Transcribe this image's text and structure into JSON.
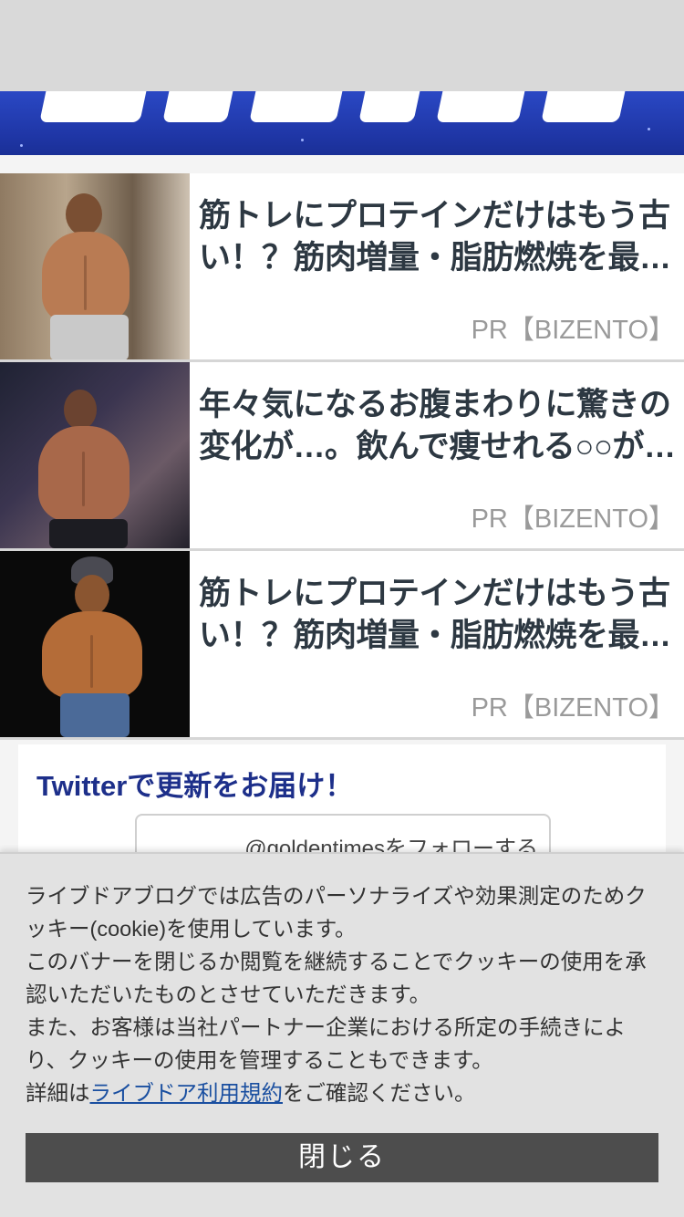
{
  "ads": [
    {
      "title": "筋トレにプロテインだけはもう古い！？筋肉増量・脂肪燃焼を最…",
      "sponsor": "PR【BIZENTO】"
    },
    {
      "title": "年々気になるお腹まわりに驚きの変化が…。飲んで痩せれる○○が…",
      "sponsor": "PR【BIZENTO】"
    },
    {
      "title": "筋トレにプロテインだけはもう古い！？筋肉増量・脂肪燃焼を最…",
      "sponsor": "PR【BIZENTO】"
    }
  ],
  "twitter": {
    "title": "Twitterで更新をお届け！",
    "follow_label": "@goldentimesをフォローする"
  },
  "cookie": {
    "line1": "ライブドアブログでは広告のパーソナライズや効果測定のためクッキー(cookie)を使用しています。",
    "line2": "このバナーを閉じるか閲覧を継続することでクッキーの使用を承認いただいたものとさせていただきます。",
    "line3": "また、お客様は当社パートナー企業における所定の手続きにより、クッキーの使用を管理することもできます。",
    "detail_prefix": "詳細は",
    "detail_link": "ライブドア利用規約",
    "detail_suffix": "をご確認ください。",
    "close_label": "閉じる"
  },
  "colors": {
    "banner": "#2a48c4",
    "title_text": "#2d3842",
    "twitter_title": "#1d2f8a",
    "close_button": "#4d4d4d"
  }
}
